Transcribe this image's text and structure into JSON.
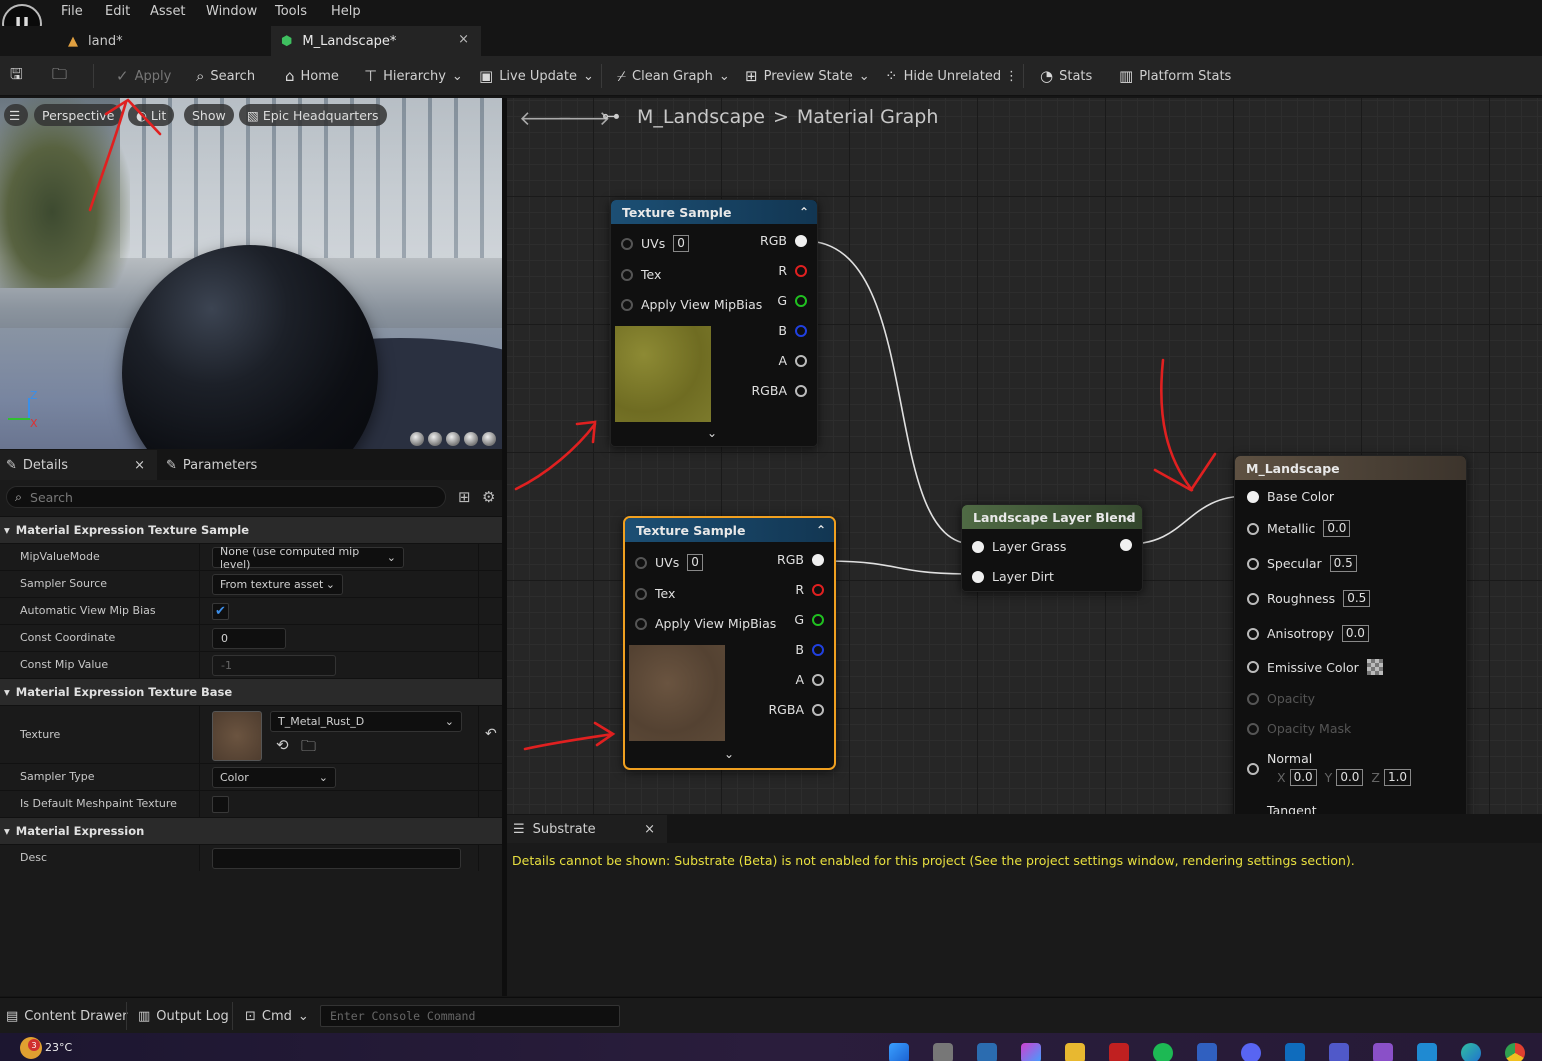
{
  "menu": [
    "File",
    "Edit",
    "Asset",
    "Window",
    "Tools",
    "Help"
  ],
  "tabs": [
    {
      "label": "land*"
    },
    {
      "label": "M_Landscape*",
      "close": "×"
    }
  ],
  "toolbar": {
    "apply": "Apply",
    "search": "Search",
    "home": "Home",
    "hierarchy": "Hierarchy",
    "live_update": "Live Update",
    "clean_graph": "Clean Graph",
    "preview_state": "Preview State",
    "hide_unrelated": "Hide Unrelated",
    "stats": "Stats",
    "platform_stats": "Platform Stats"
  },
  "viewport": {
    "perspective": "Perspective",
    "lit": "Lit",
    "show": "Show",
    "epic_hq": "Epic Headquarters",
    "axis_z": "Z",
    "axis_x": "X"
  },
  "details": {
    "tab_details": "Details",
    "tab_close": "×",
    "tab_parameters": "Parameters",
    "search_placeholder": "Search",
    "section_texture_sample": "Material Expression Texture Sample",
    "mip_value_mode_label": "MipValueMode",
    "mip_value_mode_value": "None (use computed mip level)",
    "sampler_source_label": "Sampler Source",
    "sampler_source_value": "From texture asset",
    "auto_view_mip_bias_label": "Automatic View Mip Bias",
    "auto_view_mip_bias_checked": true,
    "const_coordinate_label": "Const Coordinate",
    "const_coordinate_value": "0",
    "const_mip_value_label": "Const Mip Value",
    "const_mip_value_value": "-1",
    "section_texture_base": "Material Expression Texture Base",
    "texture_label": "Texture",
    "texture_value": "T_Metal_Rust_D",
    "sampler_type_label": "Sampler Type",
    "sampler_type_value": "Color",
    "is_default_meshpaint_label": "Is Default Meshpaint Texture",
    "section_material_expression": "Material Expression",
    "desc_label": "Desc",
    "desc_value": ""
  },
  "graph": {
    "breadcrumb_root": "M_Landscape",
    "breadcrumb_sep": ">",
    "breadcrumb_leaf": "Material Graph",
    "texture_sample_1": {
      "title": "Texture Sample",
      "inputs": [
        "UVs",
        "Tex",
        "Apply View MipBias"
      ],
      "uv_value": "0",
      "outputs": [
        "RGB",
        "R",
        "G",
        "B",
        "A",
        "RGBA"
      ]
    },
    "texture_sample_2": {
      "title": "Texture Sample",
      "inputs": [
        "UVs",
        "Tex",
        "Apply View MipBias"
      ],
      "uv_value": "0",
      "outputs": [
        "RGB",
        "R",
        "G",
        "B",
        "A",
        "RGBA"
      ]
    },
    "layer_blend": {
      "title": "Landscape Layer Blend",
      "inputs": [
        "Layer Grass",
        "Layer Dirt"
      ]
    },
    "result_node": {
      "title": "M_Landscape",
      "base_color": "Base Color",
      "metallic": "Metallic",
      "metallic_value": "0.0",
      "specular": "Specular",
      "specular_value": "0.5",
      "roughness": "Roughness",
      "roughness_value": "0.5",
      "anisotropy": "Anisotropy",
      "anisotropy_value": "0.0",
      "emissive_color": "Emissive Color",
      "opacity": "Opacity",
      "opacity_mask": "Opacity Mask",
      "normal": "Normal",
      "normal_x_label": "X",
      "normal_x": "0.0",
      "normal_y_label": "Y",
      "normal_y": "0.0",
      "normal_z_label": "Z",
      "normal_z": "1.0",
      "tangent": "Tangent"
    }
  },
  "substrate": {
    "tab": "Substrate",
    "close": "×",
    "message": "Details cannot be shown: Substrate (Beta) is not enabled for this project (See the project settings window, rendering settings section)."
  },
  "statusbar": {
    "content_drawer": "Content Drawer",
    "output_log": "Output Log",
    "cmd": "Cmd",
    "console_placeholder": "Enter Console Command"
  },
  "taskbar": {
    "weather_badge": "3",
    "temperature": "23°C"
  },
  "colors": {
    "node_title_texture": "#1c4f74",
    "node_title_blend": "#41583a",
    "node_title_result": "#5a4a3a",
    "selected_outline": "#f0a020",
    "grass_swatch": "#7f7a2a",
    "dirt_swatch": "#5a4634",
    "pin_red": "#e02020",
    "pin_green": "#20c020",
    "pin_blue": "#2040e0",
    "annotation_red": "#e02020"
  }
}
